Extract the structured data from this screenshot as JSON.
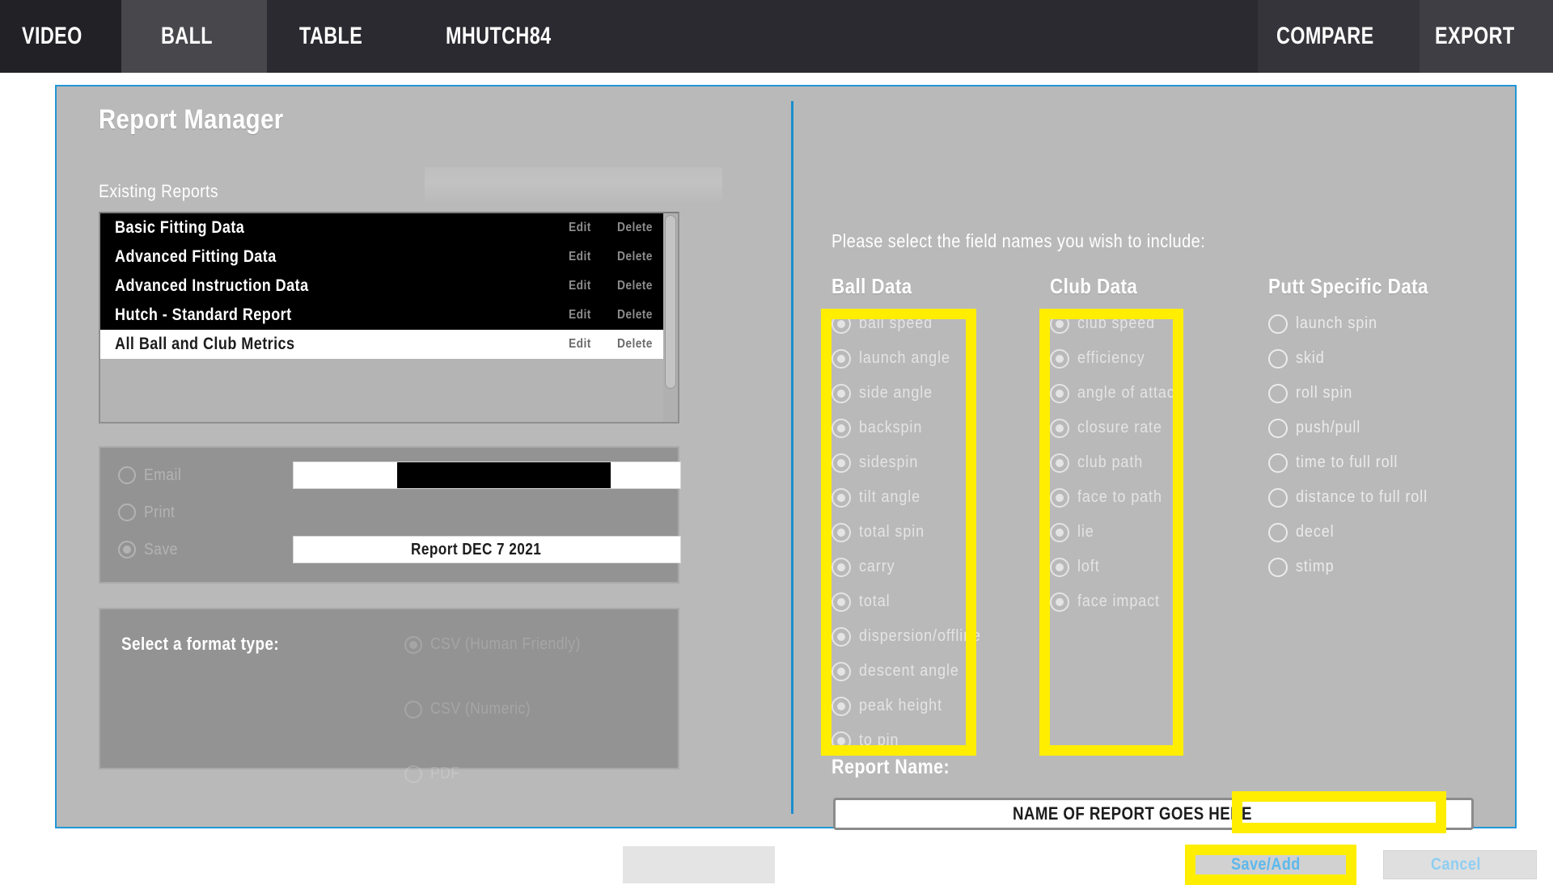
{
  "nav": {
    "tabs": [
      {
        "id": "video",
        "label": "VIDEO"
      },
      {
        "id": "ball",
        "label": "BALL"
      },
      {
        "id": "table",
        "label": "TABLE"
      },
      {
        "id": "user",
        "label": "MHUTCH84"
      }
    ],
    "right_tabs": [
      {
        "id": "compare",
        "label": "COMPARE"
      },
      {
        "id": "export",
        "label": "EXPORT"
      }
    ],
    "active_tab": "BALL"
  },
  "left": {
    "title": "Report Manager",
    "existing_reports_label": "Existing Reports",
    "report_columns": {
      "edit": "Edit",
      "delete": "Delete"
    },
    "reports": [
      {
        "name": "Basic Fitting Data",
        "selected": false
      },
      {
        "name": "Advanced Fitting Data",
        "selected": false
      },
      {
        "name": "Advanced Instruction Data",
        "selected": false
      },
      {
        "name": "Hutch - Standard Report",
        "selected": false
      },
      {
        "name": "All Ball and Club Metrics",
        "selected": true
      }
    ],
    "delivery": {
      "options": [
        {
          "label": "Email",
          "checked": false
        },
        {
          "label": "Print",
          "checked": false
        },
        {
          "label": "Save",
          "checked": true
        }
      ],
      "email_value": "",
      "save_value": "Report DEC 7 2021"
    },
    "format": {
      "label": "Select a format type:",
      "options": [
        {
          "label": "CSV (Human Friendly)",
          "checked": true
        },
        {
          "label": "CSV (Numeric)",
          "checked": false
        },
        {
          "label": "PDF",
          "checked": false
        }
      ]
    }
  },
  "right": {
    "prompt": "Please select the field names you wish to include:",
    "columns": [
      {
        "heading": "Ball Data",
        "fields": [
          {
            "label": "ball speed",
            "checked": true
          },
          {
            "label": "launch angle",
            "checked": true
          },
          {
            "label": "side angle",
            "checked": true
          },
          {
            "label": "backspin",
            "checked": true
          },
          {
            "label": "sidespin",
            "checked": true
          },
          {
            "label": "tilt angle",
            "checked": true
          },
          {
            "label": "total spin",
            "checked": true
          },
          {
            "label": "carry",
            "checked": true
          },
          {
            "label": "total",
            "checked": true
          },
          {
            "label": "dispersion/offline",
            "checked": true
          },
          {
            "label": "descent angle",
            "checked": true
          },
          {
            "label": "peak height",
            "checked": true
          },
          {
            "label": "to pin",
            "checked": true
          }
        ]
      },
      {
        "heading": "Club Data",
        "fields": [
          {
            "label": "club speed",
            "checked": true
          },
          {
            "label": "efficiency",
            "checked": true
          },
          {
            "label": "angle of attack",
            "checked": true
          },
          {
            "label": "closure rate",
            "checked": true
          },
          {
            "label": "club path",
            "checked": true
          },
          {
            "label": "face to path",
            "checked": true
          },
          {
            "label": "lie",
            "checked": true
          },
          {
            "label": "loft",
            "checked": true
          },
          {
            "label": "face impact",
            "checked": true
          }
        ]
      },
      {
        "heading": "Putt Specific Data",
        "fields": [
          {
            "label": "launch spin",
            "checked": false
          },
          {
            "label": "skid",
            "checked": false
          },
          {
            "label": "roll spin",
            "checked": false
          },
          {
            "label": "push/pull",
            "checked": false
          },
          {
            "label": "time to full roll",
            "checked": false
          },
          {
            "label": "distance to full roll",
            "checked": false
          },
          {
            "label": "decel",
            "checked": false
          },
          {
            "label": "stimp",
            "checked": false
          }
        ]
      }
    ],
    "report_name_label": "Report Name:",
    "report_name_placeholder": "NAME OF REPORT GOES HERE",
    "save_button": "Save/Add",
    "cancel_button": "Cancel"
  },
  "colors": {
    "accent_blue": "#2196d6",
    "highlight_yellow": "#ffee00",
    "panel_gray": "#b9b9b9",
    "button_text_blue": "#35a7e8"
  }
}
